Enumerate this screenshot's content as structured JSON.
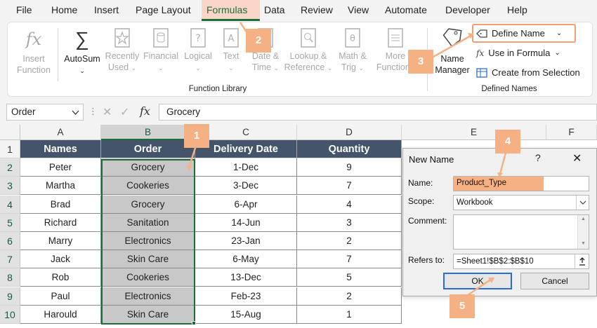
{
  "menu": {
    "tabs": [
      "File",
      "Home",
      "Insert",
      "Page Layout",
      "Formulas",
      "Data",
      "Review",
      "View",
      "Automate",
      "Developer",
      "Help"
    ],
    "active": "Formulas"
  },
  "ribbon": {
    "function_library": {
      "insert_function": [
        "Insert",
        "Function"
      ],
      "autosum": "AutoSum",
      "recently_used": [
        "Recently",
        "Used"
      ],
      "financial": "Financial",
      "logical": "Logical",
      "text": "Text",
      "date_time": [
        "Date &",
        "Time"
      ],
      "lookup": [
        "Lookup &",
        "Reference"
      ],
      "math": [
        "Math &",
        "Trig"
      ],
      "more": [
        "More",
        "Functions"
      ],
      "label": "Function Library"
    },
    "defined_names": {
      "name_manager": [
        "Name",
        "Manager"
      ],
      "define_name": "Define Name",
      "use_in_formula": "Use in Formula",
      "create_from_selection": "Create from Selection",
      "label": "Defined Names"
    }
  },
  "formula_bar": {
    "name_box": "Order",
    "fx": "fx",
    "value": "Grocery"
  },
  "sheet": {
    "columns": [
      "A",
      "B",
      "C",
      "D",
      "E",
      "F"
    ],
    "rows": [
      "1",
      "2",
      "3",
      "4",
      "5",
      "6",
      "7",
      "8",
      "9",
      "10"
    ],
    "headers": [
      "Names",
      "Order",
      "Delivery Date",
      "Quantity"
    ],
    "data": [
      [
        "Peter",
        "Grocery",
        "1-Dec",
        "9"
      ],
      [
        "Martha",
        "Cookeries",
        "3-Dec",
        "7"
      ],
      [
        "Brad",
        "Grocery",
        "6-Apr",
        "4"
      ],
      [
        "Richard",
        "Sanitation",
        "14-Jun",
        "3"
      ],
      [
        "Marry",
        "Electronics",
        "23-Jan",
        "2"
      ],
      [
        "Jack",
        "Skin Care",
        "6-May",
        "7"
      ],
      [
        "Rob",
        "Cookeries",
        "13-Dec",
        "5"
      ],
      [
        "Paul",
        "Electronics",
        "Feb-23",
        "2"
      ],
      [
        "Harould",
        "Skin Care",
        "15-Aug",
        "1"
      ]
    ]
  },
  "dialog": {
    "title": "New Name",
    "name_label": "Name:",
    "name_value": "Product_Type",
    "scope_label": "Scope:",
    "scope_value": "Workbook",
    "comment_label": "Comment:",
    "refers_label": "Refers to:",
    "refers_value": "=Sheet1!$B$2:$B$10",
    "ok": "OK",
    "cancel": "Cancel"
  },
  "callouts": [
    "1",
    "2",
    "3",
    "4",
    "5"
  ],
  "colors": {
    "accent": "#1b6e3a",
    "callout": "#f5b183",
    "header_fill": "#44546a"
  }
}
